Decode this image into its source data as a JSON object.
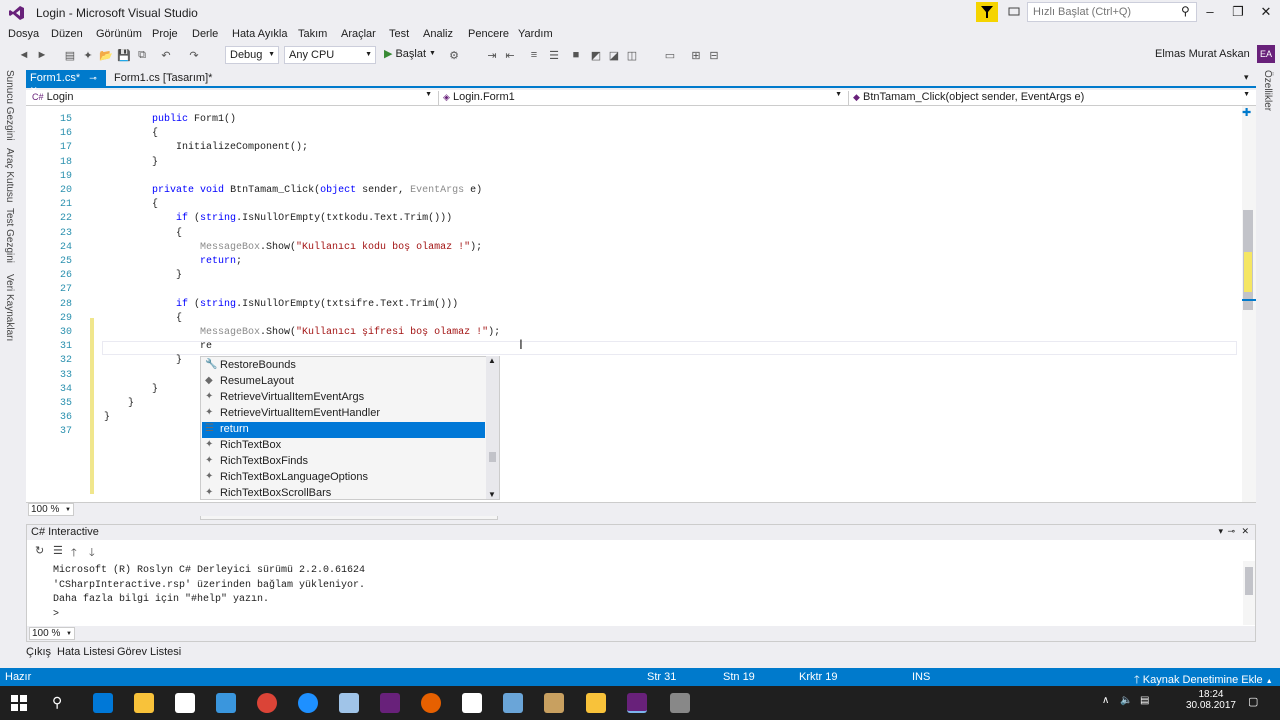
{
  "window": {
    "title": "Login - Microsoft Visual Studio"
  },
  "quick_launch": {
    "placeholder": "Hızlı Başlat (Ctrl+Q)"
  },
  "menu": [
    "Dosya",
    "Düzen",
    "Görünüm",
    "Proje",
    "Derle",
    "Hata Ayıkla",
    "Takım",
    "Araçlar",
    "Test",
    "Analiz",
    "Pencere",
    "Yardım"
  ],
  "toolbar": {
    "config": "Debug",
    "platform": "Any CPU",
    "start_label": "Başlat"
  },
  "user": {
    "name": "Elmas Murat Askan",
    "initials": "EA"
  },
  "left_tool_tabs": [
    "Sunucu Gezgini",
    "Araç Kutusu",
    "Test Gezgini",
    "Veri Kaynakları"
  ],
  "right_tool_tabs": [
    "Özellikler"
  ],
  "tabs": [
    {
      "label": "Form1.cs*"
    },
    {
      "label": "Form1.cs [Tasarım]*"
    }
  ],
  "navbar": {
    "project": "Login",
    "class": "Login.Form1",
    "member": "BtnTamam_Click(object sender, EventArgs e)"
  },
  "code": {
    "lines": [
      {
        "n": "15",
        "t": "        public Form1()"
      },
      {
        "n": "16",
        "t": "        {"
      },
      {
        "n": "17",
        "t": "            InitializeComponent();"
      },
      {
        "n": "18",
        "t": "        }"
      },
      {
        "n": "19",
        "t": ""
      },
      {
        "n": "20",
        "t": "        private void BtnTamam_Click(object sender, EventArgs e)"
      },
      {
        "n": "21",
        "t": "        {"
      },
      {
        "n": "22",
        "t": "            if (string.IsNullOrEmpty(txtkodu.Text.Trim()))"
      },
      {
        "n": "23",
        "t": "            {"
      },
      {
        "n": "24",
        "t": "                MessageBox.Show(\"Kullanıcı kodu boş olamaz !\");"
      },
      {
        "n": "25",
        "t": "                return;"
      },
      {
        "n": "26",
        "t": "            }"
      },
      {
        "n": "27",
        "t": ""
      },
      {
        "n": "28",
        "t": "            if (string.IsNullOrEmpty(txtsifre.Text.Trim()))"
      },
      {
        "n": "29",
        "t": "            {"
      },
      {
        "n": "30",
        "t": "                MessageBox.Show(\"Kullanıcı şifresi boş olamaz !\");"
      },
      {
        "n": "31",
        "t": "                re"
      },
      {
        "n": "32",
        "t": "            }"
      },
      {
        "n": "33",
        "t": ""
      },
      {
        "n": "34",
        "t": "        }"
      },
      {
        "n": "35",
        "t": "    }"
      },
      {
        "n": "36",
        "t": "}"
      },
      {
        "n": "37",
        "t": ""
      }
    ]
  },
  "autocomplete": {
    "items": [
      "RestoreBounds",
      "ResumeLayout",
      "RetrieveVirtualItemEventArgs",
      "RetrieveVirtualItemEventHandler",
      "return",
      "RichTextBox",
      "RichTextBoxFinds",
      "RichTextBoxLanguageOptions",
      "RichTextBoxScrollBars"
    ],
    "selected_index": 4
  },
  "editor_zoom": "100 %",
  "interactive": {
    "title": "C# Interactive",
    "output": [
      "Microsoft (R) Roslyn C# Derleyici sürümü 2.2.0.61624",
      "'CSharpInteractive.rsp' üzerinden bağlam yükleniyor.",
      "Daha fazla bilgi için \"#help\" yazın.",
      "> "
    ],
    "zoom": "100 %"
  },
  "bottom_tabs": [
    "Çıkış",
    "Hata Listesi",
    "Görev Listesi"
  ],
  "status": {
    "state": "Hazır",
    "line": "Str 31",
    "col": "Stn 19",
    "ch": "Krktr 19",
    "mode": "INS",
    "source_control": "Kaynak Denetimine Ekle"
  },
  "clock": {
    "time": "18:24",
    "date": "30.08.2017"
  },
  "colors": {
    "accent": "#007acc",
    "vs_purple": "#68217a",
    "selection": "#0078d7"
  }
}
